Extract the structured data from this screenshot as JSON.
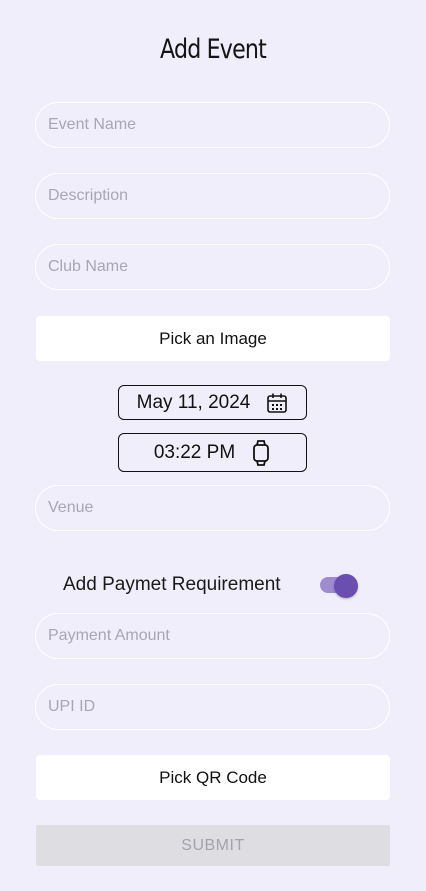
{
  "page": {
    "title": "Add Event"
  },
  "fields": {
    "event_name": {
      "placeholder": "Event Name",
      "value": ""
    },
    "description": {
      "placeholder": "Description",
      "value": ""
    },
    "club_name": {
      "placeholder": "Club Name",
      "value": ""
    },
    "venue": {
      "placeholder": "Venue",
      "value": ""
    },
    "payment_amount": {
      "placeholder": "Payment Amount",
      "value": ""
    },
    "upi_id": {
      "placeholder": "UPI ID",
      "value": ""
    }
  },
  "buttons": {
    "pick_image": "Pick an Image",
    "pick_qr": "Pick QR Code",
    "submit": "SUBMIT"
  },
  "date_picker": {
    "value": "May 11, 2024",
    "icon": "calendar-icon"
  },
  "time_picker": {
    "value": "03:22 PM",
    "icon": "watch-icon"
  },
  "payment": {
    "label": "Add Paymet Requirement",
    "enabled": true,
    "toggle_color": "#6a4fb0"
  },
  "colors": {
    "background": "#f0eefa",
    "accent": "#6a4fb0",
    "submit_disabled_bg": "#dedde2"
  }
}
